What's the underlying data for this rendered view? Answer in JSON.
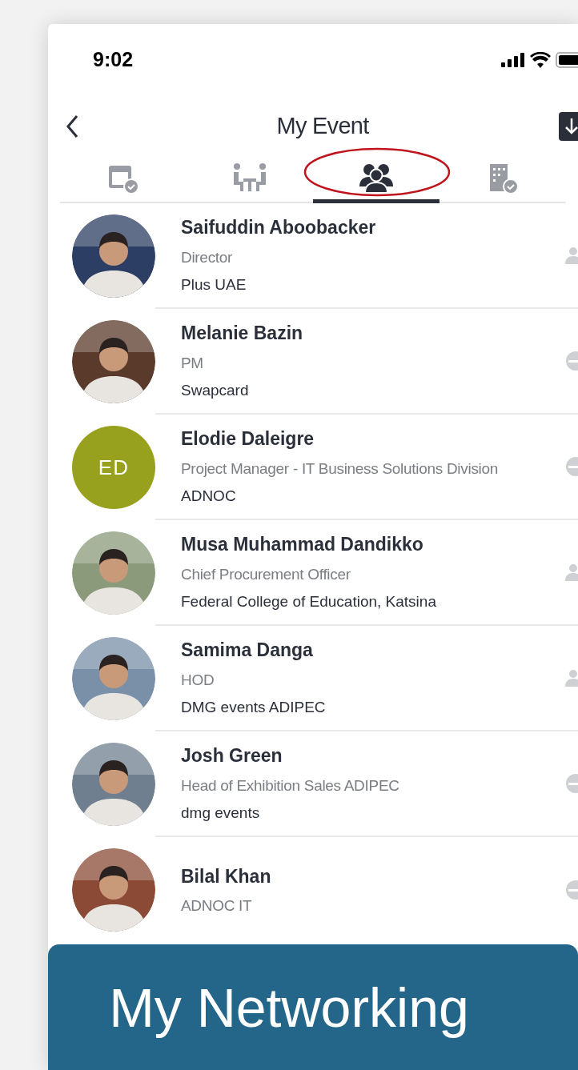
{
  "status_bar": {
    "time": "9:02"
  },
  "header": {
    "title": "My Event"
  },
  "tabs": [
    {
      "selected": false
    },
    {
      "selected": false
    },
    {
      "selected": true
    },
    {
      "selected": false
    }
  ],
  "contacts": [
    {
      "name": "Saifuddin Aboobacker",
      "title": "Director",
      "company": "Plus UAE",
      "kind": "person"
    },
    {
      "name": "Melanie Bazin",
      "title": "PM",
      "company": "Swapcard",
      "kind": "disc"
    },
    {
      "name": "Elodie Daleigre",
      "title": "Project Manager - IT Business Solutions Division",
      "company": "ADNOC",
      "avatar": {
        "kind": "initials",
        "initials": "ED",
        "color": "#98a11d"
      },
      "kind": "disc"
    },
    {
      "name": "Musa Muhammad Dandikko",
      "title": "Chief Procurement Officer",
      "company": "Federal College of Education, Katsina",
      "kind": "person"
    },
    {
      "name": "Samima Danga",
      "title": "HOD",
      "company": "DMG events ADIPEC",
      "kind": "person"
    },
    {
      "name": "Josh Green",
      "title": "Head of Exhibition Sales ADIPEC",
      "company": "dmg events",
      "kind": "disc"
    },
    {
      "name": "Bilal Khan",
      "title": "ADNOC IT",
      "kind": "disc"
    }
  ],
  "banner": {
    "text": "My Networking"
  }
}
